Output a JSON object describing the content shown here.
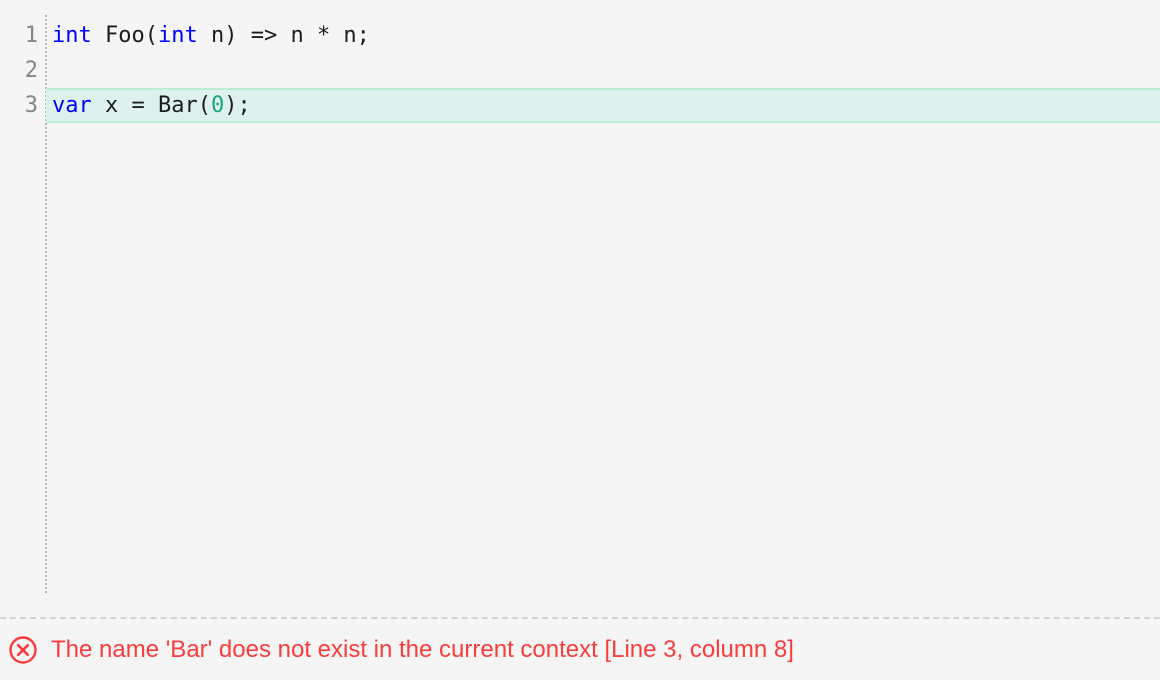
{
  "editor": {
    "language": "csharp",
    "gutter_color": "#868686",
    "background": "#f5f5f5",
    "highlight_color": "#ddf2ef",
    "highlight_border_color": "#b9f0d4",
    "lines": [
      {
        "number": "1",
        "highlighted": false,
        "tokens": [
          {
            "text": "int",
            "kind": "kw"
          },
          {
            "text": " Foo(",
            "kind": "plain"
          },
          {
            "text": "int",
            "kind": "kw"
          },
          {
            "text": " n) => n * n;",
            "kind": "plain"
          }
        ]
      },
      {
        "number": "2",
        "highlighted": false,
        "tokens": []
      },
      {
        "number": "3",
        "highlighted": true,
        "tokens": [
          {
            "text": "var",
            "kind": "kw"
          },
          {
            "text": " x = Bar(",
            "kind": "plain"
          },
          {
            "text": "0",
            "kind": "num"
          },
          {
            "text": ");",
            "kind": "plain"
          }
        ]
      }
    ]
  },
  "diagnostics": {
    "icon": "error-circle-x-icon",
    "severity": "error",
    "color": "#fa3c3c",
    "message": "The name 'Bar' does not exist in the current context [Line 3, column 8]",
    "location": {
      "line": "3",
      "column": "8"
    }
  }
}
